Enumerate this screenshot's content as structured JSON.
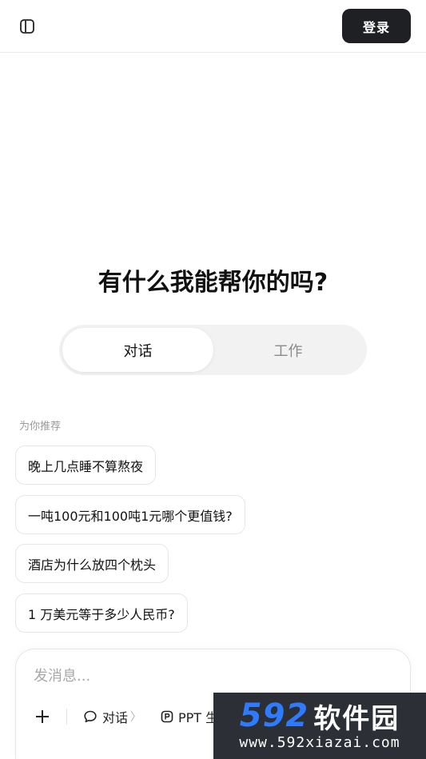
{
  "header": {
    "sidebar_toggle_icon": "sidebar-panel-icon",
    "login_label": "登录"
  },
  "hero": {
    "title": "有什么我能帮你的吗?"
  },
  "mode_switch": {
    "tabs": [
      {
        "label": "对话",
        "active": true
      },
      {
        "label": "工作",
        "active": false
      }
    ]
  },
  "recommendations": {
    "label": "为你推荐",
    "items": [
      "晚上几点睡不算熬夜",
      "一吨100元和100吨1元哪个更值钱?",
      "酒店为什么放四个枕头",
      "1 万美元等于多少人民币?"
    ]
  },
  "composer": {
    "placeholder": "发消息...",
    "tools": [
      {
        "icon": "chat-bubble-icon",
        "label": "对话",
        "chevron": "〉"
      },
      {
        "icon": "ppt-icon",
        "label": "PPT 生"
      }
    ]
  },
  "watermark": {
    "number": "592",
    "name": "软件园",
    "url": "www.592xiazai.com"
  },
  "colors": {
    "login_bg": "#1f2023",
    "switch_bg": "#f2f2f2",
    "watermark_bg": "#2c3036",
    "watermark_accent": "#2f7bff"
  }
}
